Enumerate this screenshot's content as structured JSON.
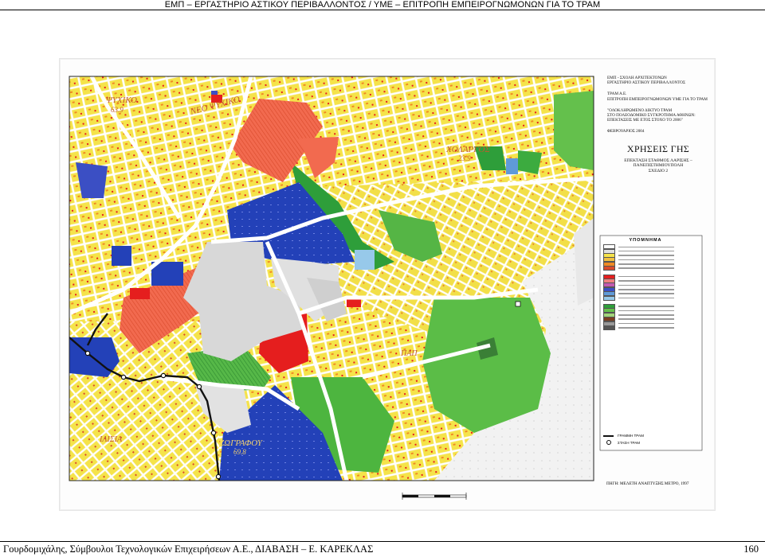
{
  "header": {
    "title": "ΕΜΠ – ΕΡΓΑΣΤΗΡΙΟ ΑΣΤΙΚΟΥ ΠΕΡΙΒΑΛΛΟΝΤΟΣ  /  ΥΜΕ – ΕΠΙΤΡΟΠΗ ΕΜΠΕΙΡΟΓΝΩΜΟΝΩΝ ΓΙΑ ΤΟ ΤΡΑΜ"
  },
  "map": {
    "title_block": {
      "institution_line1": "ΕΜΠ - ΣΧΟΛΗ ΑΡΧΙΤΕΚΤΟΝΩΝ",
      "institution_line2": "ΕΡΓΑΣΤΗΡΙΟ ΑΣΤΙΚΟΥ ΠΕΡΙΒΑΛΛΟΝΤΟΣ",
      "client_line1": "ΤΡΑΜ Α.Ε.",
      "client_line2": "ΕΠΙΤΡΟΠΗ ΕΜΠΕΙΡΟΓΝΩΜΟΝΩΝ ΥΜΕ ΓΙΑ ΤΟ ΤΡΑΜ",
      "project_line1": "\"ΟΛΟΚΛΗΡΩΜΕΝΟ ΔΙΚΤΥΟ ΤΡΑΜ",
      "project_line2": "ΣΤΟ ΠΟΛΕΟΔΟΜΙΚΟ ΣΥΓΚΡΟΤΗΜΑ ΑΘΗΝΩΝ:",
      "project_line3": "ΕΠΕΚΤΑΣΕΙΣ ΜΕ ΕΤΟΣ ΣΤΟΧΟ ΤΟ 2006\"",
      "date": "ΦΕΒΡΟΥΑΡΙΟΣ 2004",
      "heading": "ΧΡΗΣΕΙΣ ΓΗΣ",
      "subtitle_line1": "ΕΠΕΚΤΑΣΗ ΣΤΑΘΜΟΣ ΛΑΡΙΣΗΣ –",
      "subtitle_line2": "ΠΑΝΕΠΙΣΤΗΜΙΟΥΠΟΛΗ",
      "subtitle_line3": "ΣΧΕΔΙΟ 2"
    },
    "legend": {
      "title": "ΥΠΟΜΝΗΜΑ",
      "swatches": [
        "#ffffff",
        "#e0e0e0",
        "#f5e34a",
        "#f0c040",
        "#f08a24",
        "#d94a2b",
        "#e51e1e",
        "#f08080",
        "#c45ab0",
        "#3b4fc4",
        "#5f9ad8",
        "#97c9ea",
        "#2e9e3a",
        "#66c04a",
        "#a3d47a",
        "#7a3e20",
        "#9a9a9a",
        "#555555"
      ],
      "tram_line_label": "ΓΡΑΜΜΗ ΤΡΑΜ",
      "tram_stop_label": "ΣΤΑΣΗ ΤΡΑΜ"
    },
    "source_note": "ΠΗΓΗ: ΜΕΛΕΤΗ ΑΝΑΠΤΥΞΗΣ ΜΕΤΡΟ, 1997",
    "place_labels": {
      "psychiko": "ΨΥΧΙΚΟ",
      "psychiko_code": "63.9",
      "neo_psychiko": "ΝΕΟ ΨΥΧΙΚΟ",
      "cholargos": "ΧΟΛΑΡΓΟΣ",
      "cholargos_code": "23.9",
      "zografou": "ΖΩΓΡΑΦΟΥ",
      "zografou_code": "69.8",
      "papagou": "ΠΑΠ",
      "ilisia": "ΙΛΙΣΙΑ"
    },
    "colors": {
      "residential": "#f5e34a",
      "green": "#2e9e3a",
      "light_green": "#66c04a",
      "blue": "#2341b8",
      "red": "#f26a4f",
      "grey": "#d8d8d8",
      "road": "#ffffff",
      "tram": "#111111"
    }
  },
  "footer": {
    "left": "Γουρδομιχάλης, Σύμβουλοι Τεχνολογικών Επιχειρήσεων Α.Ε., ΔΙΑΒΑΣΗ – Ε. ΚΑΡΕΚΛΑΣ",
    "page_number": "160"
  }
}
